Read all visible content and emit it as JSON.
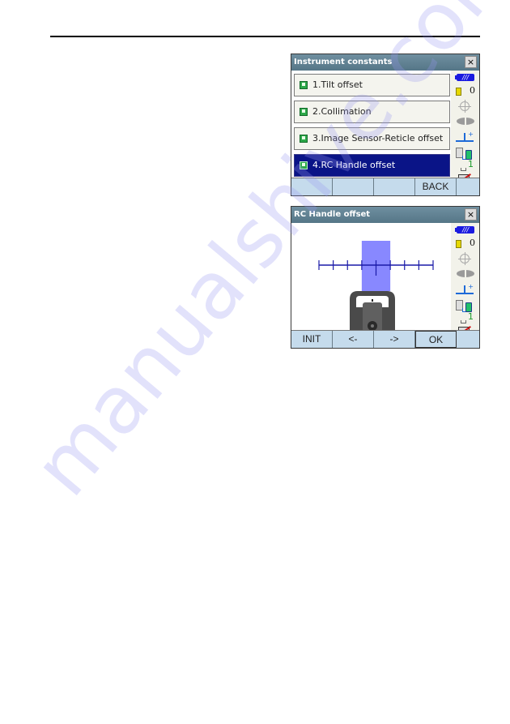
{
  "screen1": {
    "title": "Instrument constants",
    "close_label": "×",
    "menu_items": [
      {
        "label": "1.Tilt offset",
        "selected": false
      },
      {
        "label": "2.Collimation",
        "selected": false
      },
      {
        "label": "3.Image Sensor-Reticle offset",
        "selected": false
      },
      {
        "label": "4.RC Handle offset",
        "selected": true
      }
    ],
    "softkeys": [
      "",
      "",
      "",
      "BACK",
      ""
    ]
  },
  "screen2": {
    "title": "RC Handle offset",
    "close_label": "×",
    "scale": {
      "tick_count": 9,
      "highlight_range_ticks": [
        3,
        5
      ],
      "center_tick": 4
    },
    "softkeys": [
      "INIT",
      "<-",
      "->",
      "OK",
      ""
    ]
  },
  "status_bar": {
    "battery_label": "///",
    "prism_constant": "0",
    "icons": [
      "battery-icon",
      "prism-icon",
      "tilt-icon",
      "face-icon",
      "reflector-icon",
      "communication-icon",
      "input-mode-icon",
      "no-sd-icon"
    ],
    "input_mode": "1"
  },
  "colors": {
    "selected_item": "#0a1487",
    "title_bar": "#5f7f90",
    "softkey_bg": "#c5dbec",
    "scale_line": "#1a1aa8",
    "highlight": "#7b7bff"
  },
  "watermark": "manualshive.com"
}
